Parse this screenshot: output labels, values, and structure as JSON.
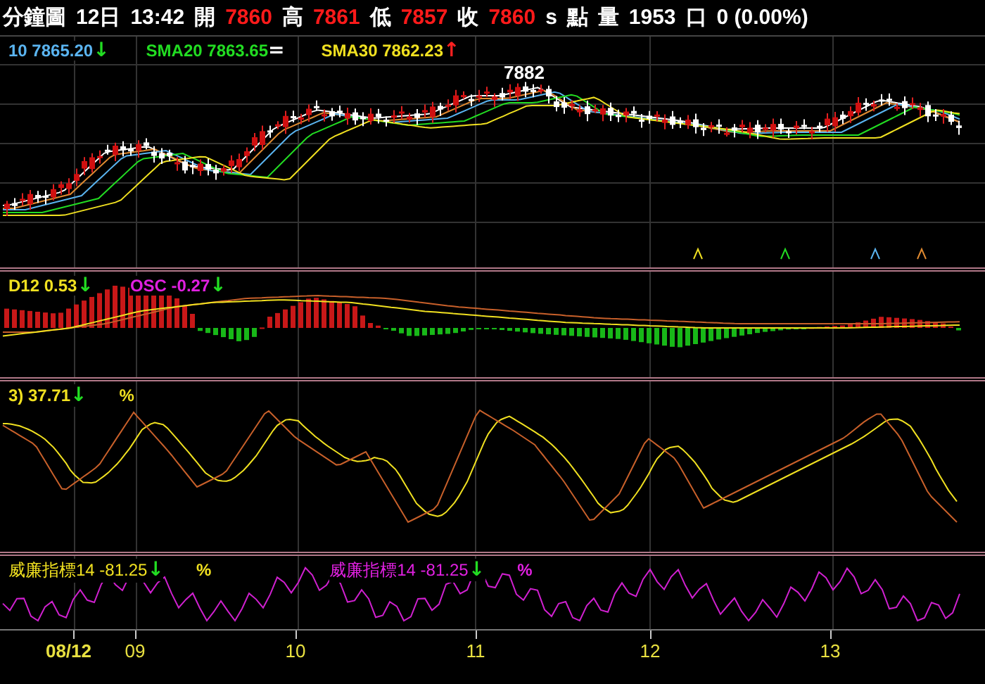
{
  "header": [
    {
      "text": "分鐘圖",
      "kind": "label"
    },
    {
      "text": "12日",
      "kind": "label"
    },
    {
      "text": "13:42",
      "kind": "label"
    },
    {
      "text": "開",
      "kind": "label"
    },
    {
      "text": "7860",
      "kind": "value"
    },
    {
      "text": "高",
      "kind": "label"
    },
    {
      "text": "7861",
      "kind": "value"
    },
    {
      "text": "低",
      "kind": "label"
    },
    {
      "text": "7857",
      "kind": "value"
    },
    {
      "text": "收",
      "kind": "label"
    },
    {
      "text": "7860",
      "kind": "value"
    },
    {
      "text": "s",
      "kind": "label"
    },
    {
      "text": "點",
      "kind": "label"
    },
    {
      "text": "量",
      "kind": "label"
    },
    {
      "text": "1953",
      "kind": "label"
    },
    {
      "text": "口",
      "kind": "label"
    },
    {
      "text": "0 (0.00%)",
      "kind": "label"
    }
  ],
  "price_panel": {
    "legend": [
      {
        "label": "10 7865.20",
        "color": "#5ab4f0",
        "arrow": {
          "text": "↓",
          "color": "#22dd22"
        }
      },
      {
        "label": "SMA20 7863.65",
        "color": "#22dd22",
        "arrow": {
          "text": "=",
          "color": "#ffffff"
        }
      },
      {
        "label": "SMA30 7862.23",
        "color": "#f0e020",
        "arrow": {
          "text": "↑",
          "color": "#ff2020"
        }
      }
    ],
    "peak_label": "7882"
  },
  "macd_panel": {
    "legend": [
      {
        "label": "D12 0.53",
        "color": "#f0e020",
        "arrow": {
          "text": "↓",
          "color": "#22dd22"
        }
      },
      {
        "label": "OSC -0.27",
        "color": "#e020e0",
        "arrow": {
          "text": "↓",
          "color": "#22dd22"
        }
      }
    ]
  },
  "kd_panel": {
    "legend": [
      {
        "label": "3) 37.71",
        "color": "#f0e020",
        "arrow": {
          "text": "↓",
          "color": "#22dd22"
        },
        "unit": "%"
      }
    ]
  },
  "williams_panel": {
    "legend": [
      {
        "label": "威廉指標14 -81.25",
        "color": "#f0e020",
        "arrow": {
          "text": "↓",
          "color": "#22dd22"
        },
        "unit": "%"
      },
      {
        "label": "威廉指標14 -81.25",
        "color": "#e020e0",
        "arrow": {
          "text": "↓",
          "color": "#22dd22"
        },
        "unit": "%"
      }
    ]
  },
  "x_axis": [
    {
      "text": "08/12",
      "bold": true
    },
    {
      "text": "09",
      "bold": false
    },
    {
      "text": "10",
      "bold": false
    },
    {
      "text": "11",
      "bold": false
    },
    {
      "text": "12",
      "bold": false
    },
    {
      "text": "13",
      "bold": false
    }
  ]
}
